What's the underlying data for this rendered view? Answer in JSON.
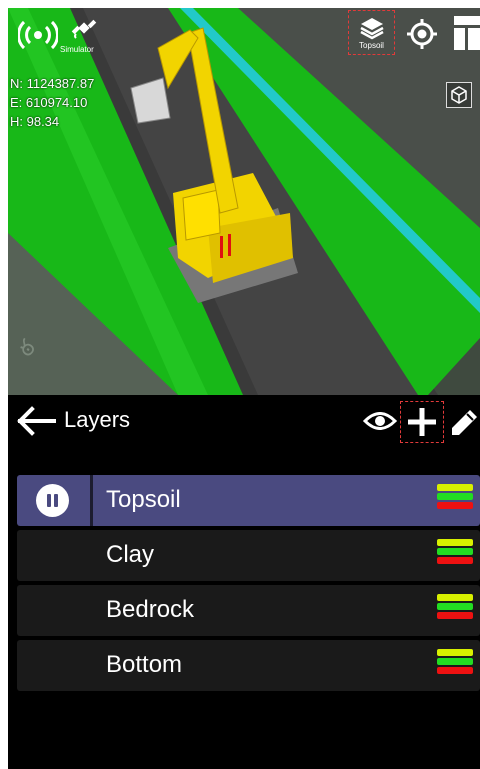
{
  "viewport": {
    "status_icons": [
      "wireless-signal-icon",
      "satellite-icon"
    ],
    "simulator_label": "Simulator",
    "coordinates": {
      "north": "N: 1124387.87",
      "east": "E: 610974.10",
      "height": "H: 98.34"
    },
    "toolbar": {
      "layer_button_label": "Topsoil",
      "icons": [
        "layers-icon",
        "crosshair-icon",
        "panels-icon",
        "cube-icon"
      ]
    }
  },
  "panel": {
    "title": "Layers",
    "header_icons": [
      "back-arrow-icon",
      "eye-icon",
      "plus-icon",
      "pencil-icon"
    ],
    "layers": [
      {
        "name": "Topsoil",
        "active": true
      },
      {
        "name": "Clay",
        "active": false
      },
      {
        "name": "Bedrock",
        "active": false
      },
      {
        "name": "Bottom",
        "active": false
      }
    ],
    "swatch_colors": [
      "#d8f000",
      "#22dd22",
      "#ee1111"
    ]
  },
  "colors": {
    "active_row": "#4a4a80",
    "row": "#1a1a1a",
    "highlight_dash": "#e23a3a"
  }
}
